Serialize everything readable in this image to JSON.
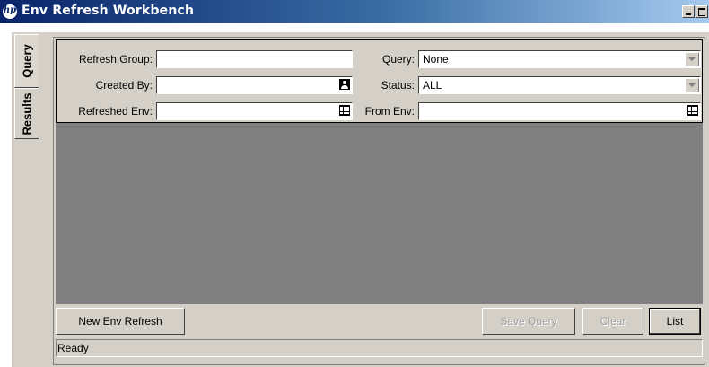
{
  "window": {
    "title": "Env Refresh Workbench",
    "logo_text": "hp",
    "minimize_icon": "minimize-icon",
    "maximize_icon": "maximize-icon"
  },
  "side_tabs": [
    {
      "label": "Query",
      "active": true
    },
    {
      "label": "Results",
      "active": false
    }
  ],
  "form": {
    "refresh_group": {
      "label": "Refresh Group:",
      "value": ""
    },
    "created_by": {
      "label": "Created By:",
      "value": "",
      "icon": "person-picker-icon"
    },
    "refreshed_env": {
      "label": "Refreshed Env:",
      "value": "",
      "icon": "list-picker-icon"
    },
    "query": {
      "label": "Query:",
      "value": "None",
      "icon": "dropdown-arrow-icon"
    },
    "status": {
      "label": "Status:",
      "value": "ALL",
      "icon": "dropdown-arrow-icon"
    },
    "from_env": {
      "label": "From Env:",
      "value": "",
      "icon": "list-picker-icon"
    }
  },
  "buttons": {
    "new_env_refresh": "New Env Refresh",
    "save_query": "Save Query",
    "clear": "Clear",
    "list": "List"
  },
  "status_bar": {
    "text": "Ready"
  },
  "colors": {
    "titlebar_start": "#0a246a",
    "titlebar_end": "#a6caf0",
    "panel_bg": "#d4d0c8",
    "results_bg": "#808080"
  }
}
